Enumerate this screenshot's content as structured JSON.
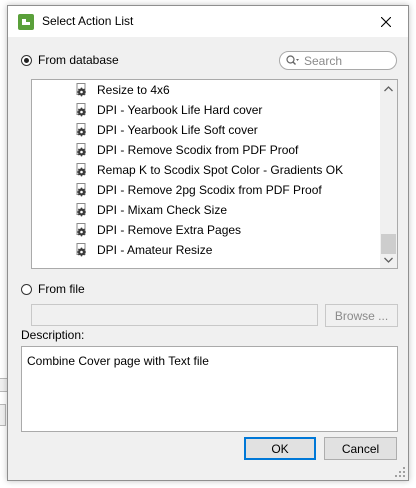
{
  "window": {
    "title": "Select Action List"
  },
  "source": {
    "database_label": "From database",
    "database_selected": true,
    "file_label": "From file",
    "file_selected": false,
    "file_path": ""
  },
  "search": {
    "placeholder": "Search"
  },
  "actions": [
    "Resize to 4x6",
    "DPI - Yearbook Life Hard cover",
    "DPI - Yearbook Life Soft cover",
    "DPI - Remove Scodix from PDF Proof",
    "Remap K to Scodix Spot Color - Gradients OK",
    "DPI - Remove 2pg Scodix from PDF Proof",
    "DPI - Mixam Check Size",
    "DPI - Remove Extra Pages",
    "DPI - Amateur Resize"
  ],
  "buttons": {
    "browse": "Browse ...",
    "ok": "OK",
    "cancel": "Cancel"
  },
  "description": {
    "label": "Description:",
    "text": "Combine Cover page with Text file"
  },
  "colors": {
    "accent": "#0078d7",
    "app_icon": "#5aa03a"
  },
  "icons": {
    "app": "app-icon",
    "close": "close-icon",
    "search": "search-icon",
    "action": "gear-icon",
    "scroll_up": "chevron-up-icon",
    "scroll_down": "chevron-down-icon",
    "resize": "resize-grip-icon"
  }
}
